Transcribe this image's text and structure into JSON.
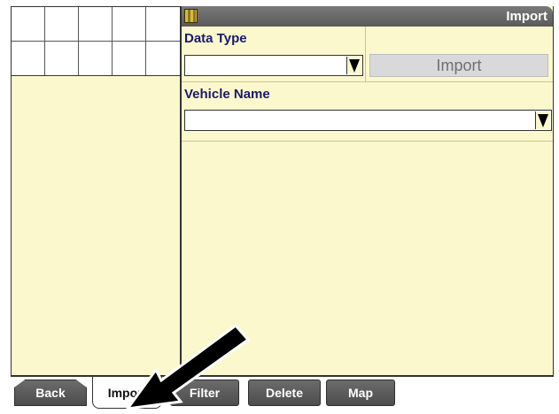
{
  "window": {
    "title": "Import"
  },
  "form": {
    "data_type": {
      "label": "Data Type",
      "value": ""
    },
    "import_button_label": "Import",
    "vehicle_name": {
      "label": "Vehicle Name",
      "value": ""
    }
  },
  "tabs": [
    {
      "label": "Back"
    },
    {
      "label": "Import",
      "selected": true
    },
    {
      "label": "Filter"
    },
    {
      "label": "Delete"
    },
    {
      "label": "Map"
    }
  ],
  "colors": {
    "panel_background": "#fcf8cd",
    "title_bar": "#6a6a6a",
    "label_text": "#1a1a6e",
    "tab_background": "#5a5a5a",
    "disabled_button": "#d9d9d9"
  },
  "icons": {
    "app_icon": "file-transfer-icon",
    "dropdown_arrow": "triangle-down-icon",
    "pointer_arrow": "arrow-pointer-icon"
  }
}
